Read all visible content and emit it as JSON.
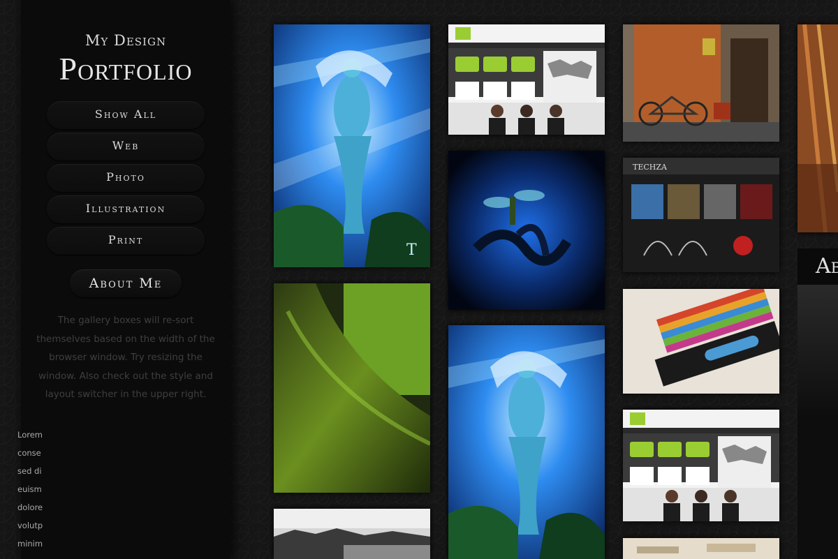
{
  "sidebar": {
    "subtitle": "My Design",
    "title": "Portfolio",
    "nav": [
      {
        "label": "Show All"
      },
      {
        "label": "Web"
      },
      {
        "label": "Photo"
      },
      {
        "label": "Illustration"
      },
      {
        "label": "Print"
      }
    ],
    "about_button": "About Me",
    "about_text": "The gallery boxes will re-sort themselves based on the width of the browser window. Try resizing the window. Also check out the style and layout switcher in the upper right."
  },
  "gallery": {
    "tiles": [
      {
        "id": "ice-goddess-illustration",
        "category": "Illustration"
      },
      {
        "id": "web-template-screenshot",
        "category": "Web"
      },
      {
        "id": "bicycle-doorway-photo",
        "category": "Photo"
      },
      {
        "id": "partial-photo-right",
        "category": "Photo"
      },
      {
        "id": "robot-characters-web",
        "category": "Web"
      },
      {
        "id": "blue-snake-dragonfly",
        "category": "Illustration"
      },
      {
        "id": "mossy-tree-root-photo",
        "category": "Photo"
      },
      {
        "id": "color-cards-print",
        "category": "Print"
      },
      {
        "id": "ice-goddess-illustration-2",
        "category": "Illustration"
      },
      {
        "id": "web-template-screenshot-2",
        "category": "Web"
      },
      {
        "id": "harbor-town-photo",
        "category": "Photo"
      },
      {
        "id": "print-partial-bottom",
        "category": "Print"
      }
    ]
  },
  "about_panel": {
    "heading": "About",
    "lines": [
      "Lorem",
      "conse",
      "sed di",
      "euism",
      "dolore",
      "volutp",
      "minim"
    ]
  },
  "colors": {
    "background": "#161616",
    "sidebar": "#0b0b0b",
    "accent_green": "#9acd32",
    "accent_blue": "#2a8cff"
  }
}
